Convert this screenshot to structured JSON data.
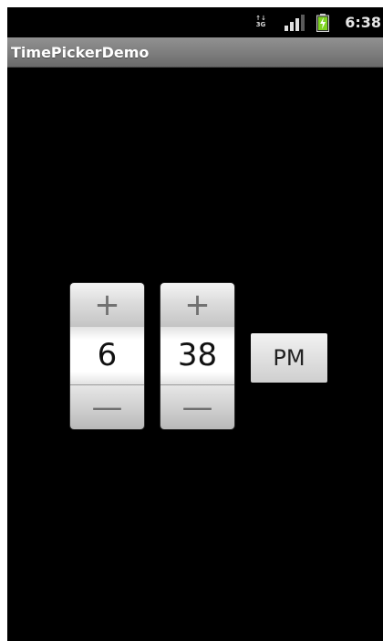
{
  "status_bar": {
    "network_label_top": "↑↓",
    "network_label_bottom": "3G",
    "icons": [
      "network-3g-icon",
      "signal-strength-icon",
      "battery-charging-icon"
    ],
    "time": "6:38"
  },
  "app": {
    "title": "TimePickerDemo"
  },
  "time_picker": {
    "hour": {
      "increment_label": "+",
      "value": "6",
      "decrement_label": "—"
    },
    "minute": {
      "increment_label": "+",
      "value": "38",
      "decrement_label": "—"
    },
    "am_pm_label": "PM"
  },
  "colors": {
    "screen_background": "#000000",
    "title_bar": "#7d7d7d",
    "battery_charge": "#7ed321"
  }
}
